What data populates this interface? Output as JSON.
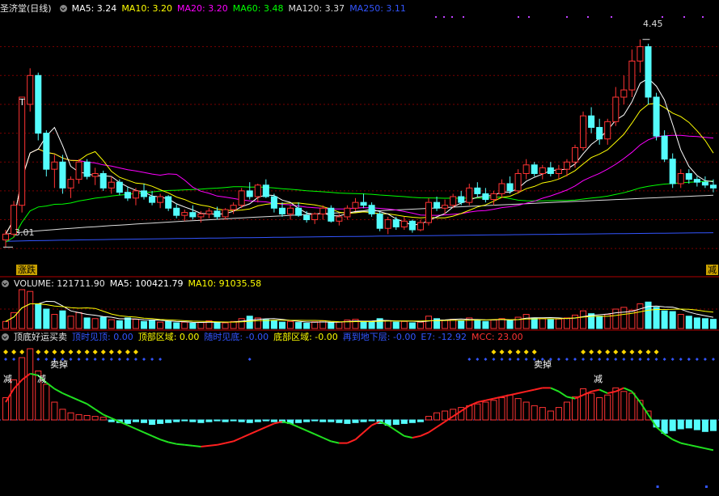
{
  "panel1": {
    "title": "圣济堂(日线)",
    "indicators": [
      {
        "label": "MA5: 3.24",
        "color": "#ffffff"
      },
      {
        "label": "MA10: 3.20",
        "color": "#ffff00"
      },
      {
        "label": "MA20: 3.20",
        "color": "#ff00ff"
      },
      {
        "label": "MA60: 3.48",
        "color": "#00ff00"
      },
      {
        "label": "MA120: 3.37",
        "color": "#dddddd"
      },
      {
        "label": "MA250: 3.11",
        "color": "#3355ff"
      }
    ],
    "high_label": "4.45",
    "low_label": "3.01",
    "left_badge": "涨跌",
    "right_badge": "减",
    "t_marker": "T"
  },
  "panel2": {
    "title": "VOLUME: 121711.90",
    "indicators": [
      {
        "label": "MA5: 100421.79",
        "color": "#ffffff"
      },
      {
        "label": "MA10: 91035.58",
        "color": "#ffff00"
      }
    ]
  },
  "panel3": {
    "title": "顶底好运买卖",
    "indicators": [
      {
        "label": "顶时见顶: 0.00",
        "color": "#3355ff"
      },
      {
        "label": "顶部区域: 0.00",
        "color": "#ffff00"
      },
      {
        "label": "随时见底: -0.00",
        "color": "#3355ff"
      },
      {
        "label": "底部区域: -0.00",
        "color": "#ffff00"
      },
      {
        "label": "再到地下层: -0.00",
        "color": "#3355ff"
      },
      {
        "label": "E7: -12.92",
        "color": "#3355ff"
      },
      {
        "label": "MCC: 23.00",
        "color": "#ff3333"
      }
    ],
    "sell_labels": [
      "卖掉",
      "卖掉"
    ],
    "reduce_labels": [
      "减",
      "减",
      "减"
    ]
  },
  "colors": {
    "up": "#ff3333",
    "down": "#54fcfc",
    "grid": "#7a0000",
    "bg": "#000000"
  },
  "chart_data": [
    {
      "type": "candlestick",
      "title": "圣济堂(日线)",
      "n_bars": 88,
      "ylim": [
        2.9,
        4.6
      ],
      "candles": [
        [
          3.06,
          3.13,
          3.01,
          3.1
        ],
        [
          3.1,
          3.33,
          3.08,
          3.3
        ],
        [
          3.3,
          4.05,
          3.25,
          4.05
        ],
        [
          4.0,
          4.25,
          3.95,
          4.2
        ],
        [
          4.2,
          4.22,
          3.75,
          3.8
        ],
        [
          3.8,
          3.82,
          3.5,
          3.55
        ],
        [
          3.55,
          3.65,
          3.42,
          3.6
        ],
        [
          3.6,
          3.65,
          3.38,
          3.42
        ],
        [
          3.42,
          3.5,
          3.35,
          3.48
        ],
        [
          3.48,
          3.62,
          3.45,
          3.6
        ],
        [
          3.6,
          3.62,
          3.48,
          3.5
        ],
        [
          3.5,
          3.56,
          3.44,
          3.52
        ],
        [
          3.52,
          3.54,
          3.4,
          3.42
        ],
        [
          3.42,
          3.5,
          3.38,
          3.46
        ],
        [
          3.46,
          3.48,
          3.37,
          3.39
        ],
        [
          3.39,
          3.43,
          3.33,
          3.35
        ],
        [
          3.35,
          3.42,
          3.3,
          3.4
        ],
        [
          3.4,
          3.45,
          3.34,
          3.36
        ],
        [
          3.36,
          3.4,
          3.3,
          3.32
        ],
        [
          3.32,
          3.38,
          3.28,
          3.36
        ],
        [
          3.36,
          3.37,
          3.26,
          3.28
        ],
        [
          3.28,
          3.31,
          3.21,
          3.23
        ],
        [
          3.23,
          3.27,
          3.19,
          3.25
        ],
        [
          3.25,
          3.3,
          3.2,
          3.22
        ],
        [
          3.22,
          3.26,
          3.18,
          3.24
        ],
        [
          3.24,
          3.28,
          3.21,
          3.26
        ],
        [
          3.26,
          3.29,
          3.2,
          3.22
        ],
        [
          3.22,
          3.28,
          3.2,
          3.27
        ],
        [
          3.27,
          3.32,
          3.24,
          3.3
        ],
        [
          3.3,
          3.42,
          3.28,
          3.4
        ],
        [
          3.4,
          3.46,
          3.34,
          3.36
        ],
        [
          3.36,
          3.45,
          3.32,
          3.44
        ],
        [
          3.44,
          3.48,
          3.35,
          3.36
        ],
        [
          3.36,
          3.38,
          3.25,
          3.28
        ],
        [
          3.28,
          3.32,
          3.22,
          3.24
        ],
        [
          3.24,
          3.3,
          3.2,
          3.28
        ],
        [
          3.28,
          3.32,
          3.22,
          3.23
        ],
        [
          3.23,
          3.26,
          3.18,
          3.2
        ],
        [
          3.2,
          3.25,
          3.17,
          3.24
        ],
        [
          3.24,
          3.3,
          3.2,
          3.28
        ],
        [
          3.28,
          3.3,
          3.18,
          3.19
        ],
        [
          3.19,
          3.24,
          3.16,
          3.22
        ],
        [
          3.22,
          3.3,
          3.2,
          3.28
        ],
        [
          3.28,
          3.35,
          3.26,
          3.32
        ],
        [
          3.32,
          3.38,
          3.28,
          3.3
        ],
        [
          3.3,
          3.32,
          3.22,
          3.24
        ],
        [
          3.24,
          3.26,
          3.12,
          3.14
        ],
        [
          3.14,
          3.22,
          3.1,
          3.2
        ],
        [
          3.2,
          3.22,
          3.13,
          3.15
        ],
        [
          3.15,
          3.22,
          3.13,
          3.19
        ],
        [
          3.19,
          3.2,
          3.11,
          3.13
        ],
        [
          3.13,
          3.2,
          3.12,
          3.18
        ],
        [
          3.18,
          3.35,
          3.16,
          3.32
        ],
        [
          3.32,
          3.36,
          3.26,
          3.28
        ],
        [
          3.28,
          3.34,
          3.24,
          3.3
        ],
        [
          3.3,
          3.38,
          3.28,
          3.36
        ],
        [
          3.36,
          3.4,
          3.3,
          3.32
        ],
        [
          3.32,
          3.45,
          3.3,
          3.42
        ],
        [
          3.42,
          3.46,
          3.36,
          3.38
        ],
        [
          3.38,
          3.42,
          3.32,
          3.34
        ],
        [
          3.34,
          3.4,
          3.3,
          3.38
        ],
        [
          3.38,
          3.48,
          3.35,
          3.45
        ],
        [
          3.45,
          3.5,
          3.38,
          3.4
        ],
        [
          3.4,
          3.55,
          3.38,
          3.52
        ],
        [
          3.52,
          3.62,
          3.48,
          3.58
        ],
        [
          3.58,
          3.6,
          3.5,
          3.52
        ],
        [
          3.52,
          3.58,
          3.48,
          3.56
        ],
        [
          3.56,
          3.6,
          3.5,
          3.52
        ],
        [
          3.52,
          3.58,
          3.48,
          3.55
        ],
        [
          3.55,
          3.62,
          3.5,
          3.6
        ],
        [
          3.6,
          3.72,
          3.56,
          3.7
        ],
        [
          3.7,
          3.95,
          3.68,
          3.92
        ],
        [
          3.92,
          3.98,
          3.8,
          3.84
        ],
        [
          3.84,
          3.9,
          3.72,
          3.76
        ],
        [
          3.76,
          3.9,
          3.72,
          3.88
        ],
        [
          3.88,
          4.12,
          3.85,
          4.05
        ],
        [
          4.05,
          4.2,
          4.0,
          4.1
        ],
        [
          4.1,
          4.38,
          4.05,
          4.3
        ],
        [
          4.3,
          4.45,
          4.22,
          4.4
        ],
        [
          4.4,
          4.42,
          4.0,
          4.05
        ],
        [
          4.05,
          4.08,
          3.75,
          3.78
        ],
        [
          3.78,
          3.82,
          3.6,
          3.62
        ],
        [
          3.62,
          3.66,
          3.42,
          3.45
        ],
        [
          3.45,
          3.55,
          3.42,
          3.52
        ],
        [
          3.52,
          3.55,
          3.45,
          3.48
        ],
        [
          3.48,
          3.5,
          3.43,
          3.46
        ],
        [
          3.46,
          3.5,
          3.42,
          3.44
        ],
        [
          3.44,
          3.48,
          3.39,
          3.42
        ]
      ]
    },
    {
      "type": "bar",
      "title": "VOLUME",
      "values": [
        20,
        45,
        110,
        105,
        70,
        55,
        40,
        50,
        35,
        45,
        30,
        28,
        32,
        25,
        22,
        30,
        26,
        20,
        24,
        18,
        20,
        16,
        18,
        15,
        17,
        22,
        18,
        16,
        20,
        28,
        35,
        30,
        25,
        22,
        18,
        20,
        17,
        15,
        19,
        22,
        16,
        18,
        24,
        26,
        20,
        18,
        28,
        22,
        18,
        20,
        16,
        18,
        35,
        28,
        24,
        26,
        22,
        30,
        25,
        20,
        24,
        28,
        22,
        32,
        40,
        30,
        28,
        25,
        27,
        30,
        38,
        50,
        42,
        35,
        40,
        55,
        60,
        52,
        70,
        75,
        60,
        50,
        48,
        40,
        35,
        30,
        28,
        26
      ]
    },
    {
      "type": "bar",
      "title": "顶底好运买卖",
      "values": [
        25,
        45,
        70,
        80,
        55,
        40,
        20,
        12,
        8,
        6,
        5,
        4,
        3,
        -2,
        -3,
        -4,
        -2,
        -3,
        -5,
        -4,
        -3,
        -2,
        -1,
        -2,
        -3,
        -2,
        -1,
        -2,
        -1,
        -2,
        -3,
        -2,
        -1,
        -2,
        -3,
        -4,
        -3,
        -2,
        -1,
        -2,
        -2,
        -3,
        -4,
        -3,
        -2,
        -1,
        -4,
        -6,
        -5,
        -4,
        -3,
        -2,
        4,
        8,
        10,
        12,
        14,
        16,
        18,
        20,
        22,
        25,
        28,
        24,
        20,
        16,
        14,
        10,
        14,
        20,
        26,
        35,
        30,
        25,
        28,
        36,
        32,
        30,
        22,
        10,
        -8,
        -15,
        -12,
        -10,
        -9,
        -11,
        -13,
        -12
      ],
      "curve": [
        20,
        35,
        45,
        52,
        50,
        42,
        35,
        30,
        26,
        22,
        18,
        12,
        6,
        2,
        -2,
        -6,
        -10,
        -14,
        -18,
        -22,
        -25,
        -27,
        -28,
        -29,
        -30,
        -29,
        -28,
        -26,
        -24,
        -20,
        -16,
        -12,
        -8,
        -4,
        -2,
        -4,
        -8,
        -12,
        -16,
        -20,
        -24,
        -26,
        -26,
        -22,
        -14,
        -6,
        -2,
        -6,
        -12,
        -18,
        -20,
        -18,
        -14,
        -8,
        -2,
        4,
        10,
        16,
        20,
        22,
        24,
        26,
        28,
        30,
        32,
        34,
        36,
        36,
        32,
        26,
        24,
        28,
        32,
        34,
        30,
        32,
        36,
        32,
        20,
        6,
        -8,
        -16,
        -22,
        -26,
        -28,
        -30,
        -32,
        -34
      ],
      "curve_colors": {
        "rising": "#ff2020",
        "falling": "#20e020"
      }
    }
  ]
}
